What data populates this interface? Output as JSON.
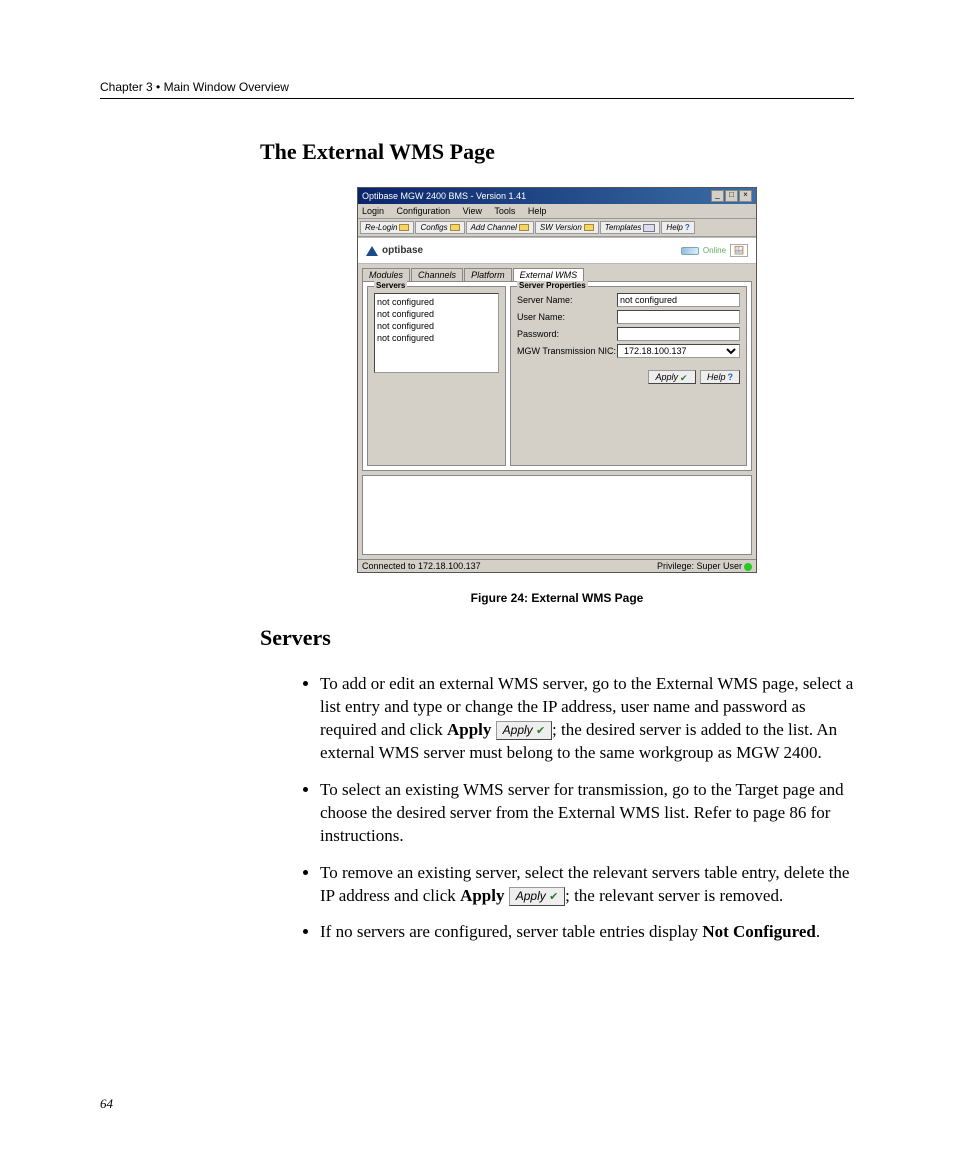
{
  "header": {
    "chapter": "Chapter 3 • Main Window Overview"
  },
  "title1": "The External WMS Page",
  "figure": {
    "caption": "Figure 24: External WMS Page",
    "window_title": "Optibase MGW 2400 BMS - Version 1.41",
    "menus": [
      "Login",
      "Configuration",
      "View",
      "Tools",
      "Help"
    ],
    "toolbar": {
      "relogin": "Re-Login",
      "configs": "Configs",
      "add_channel": "Add Channel",
      "sw_version": "SW Version",
      "templates": "Templates",
      "help": "Help",
      "help_q": "?"
    },
    "logo_text": "optibase",
    "online_text": "Online",
    "tabs": {
      "modules": "Modules",
      "channels": "Channels",
      "platform": "Platform",
      "external_wms": "External WMS"
    },
    "servers_legend": "Servers",
    "servers_items": [
      "not configured",
      "not configured",
      "not configured",
      "not configured"
    ],
    "props_legend": "Server Properties",
    "props": {
      "server_name_label": "Server Name:",
      "server_name_value": "not configured",
      "user_name_label": "User Name:",
      "user_name_value": "",
      "password_label": "Password:",
      "password_value": "",
      "nic_label": "MGW Transmission NIC:",
      "nic_value": "172.18.100.137"
    },
    "apply_btn": "Apply",
    "help_btn": "Help",
    "status_left": "Connected to 172.18.100.137",
    "status_right": "Privilege: Super User"
  },
  "title2": "Servers",
  "list": {
    "item1a": "To add or edit an external WMS server, go to the External WMS page, select a list entry and type or change the IP address, user name and password as required and click ",
    "item1_apply_word": "Apply",
    "item1b": "; the desired server is added to the list. An external WMS server must belong to the same workgroup as MGW 2400.",
    "item2": "To select an existing WMS server for transmission, go to the Target page and choose the desired server from the External WMS list. Refer to page 86 for instructions.",
    "item3a": "To remove an existing server, select the relevant servers table entry, delete the IP address and click ",
    "item3_apply_word": "Apply",
    "item3b": "; the relevant server is removed.",
    "item4a": "If no servers are configured, server table entries display ",
    "item4_bold": "Not Configured",
    "item4b": "."
  },
  "inline_apply": {
    "label": "Apply"
  },
  "page_number": "64"
}
